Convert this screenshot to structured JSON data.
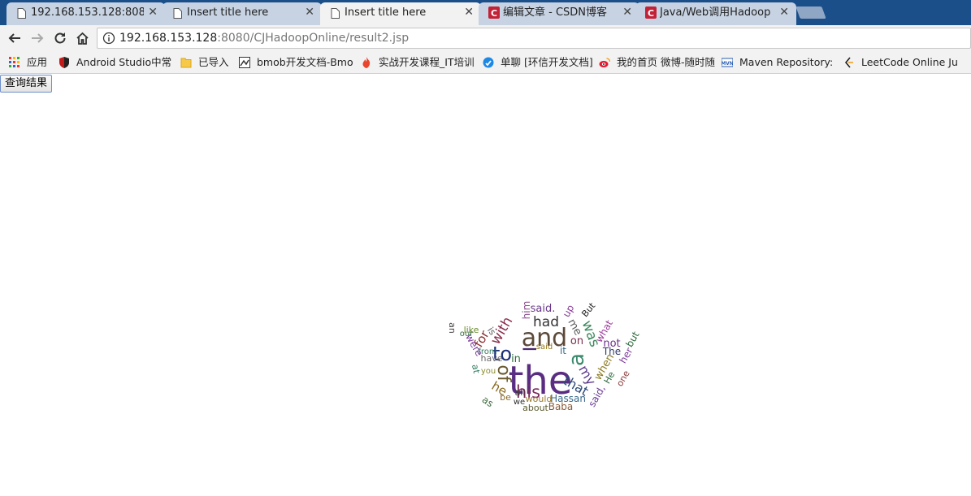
{
  "tabs": [
    {
      "title": "192.168.153.128:8080/",
      "icon": "page-icon"
    },
    {
      "title": "Insert title here",
      "icon": "page-icon"
    },
    {
      "title": "Insert title here",
      "icon": "page-icon",
      "active": true
    },
    {
      "title": "编辑文章 - CSDN博客",
      "icon": "csdn-icon"
    },
    {
      "title": "Java/Web调用Hadoop",
      "icon": "csdn-icon"
    }
  ],
  "address": {
    "host": "192.168.153.128",
    "rest": ":8080/CJHadoopOnline/result2.jsp"
  },
  "bookmarks": [
    {
      "label": "应用",
      "icon": "apps-icon"
    },
    {
      "label": "Android Studio中常",
      "icon": "shield-icon"
    },
    {
      "label": "已导入",
      "icon": "folder-icon"
    },
    {
      "label": "bmob开发文档-Bmo",
      "icon": "bmob-icon"
    },
    {
      "label": "实战开发课程_IT培训",
      "icon": "flame-icon"
    },
    {
      "label": "单聊 [环信开发文档]",
      "icon": "easemob-icon"
    },
    {
      "label": "我的首页 微博-随时随",
      "icon": "weibo-icon"
    },
    {
      "label": "Maven Repository:",
      "icon": "maven-icon"
    },
    {
      "label": "LeetCode Online Ju",
      "icon": "leetcode-icon"
    }
  ],
  "page": {
    "query_button": "查询结果"
  },
  "word_cloud": [
    {
      "text": "the",
      "color": "#5a2d82"
    },
    {
      "text": "and",
      "color": "#5b4a3a"
    },
    {
      "text": "a",
      "color": "#3a8a6e"
    },
    {
      "text": "to",
      "color": "#1c2d7a"
    },
    {
      "text": "of",
      "color": "#6a5a2e"
    },
    {
      "text": "his",
      "color": "#7a2d5a"
    },
    {
      "text": "I",
      "color": "#4b2a6e"
    },
    {
      "text": "had",
      "color": "#333333"
    },
    {
      "text": "was",
      "color": "#3d8a5e"
    },
    {
      "text": "with",
      "color": "#8a2e4e"
    },
    {
      "text": "he",
      "color": "#8a6a1e"
    },
    {
      "text": "my",
      "color": "#5a3a8a"
    },
    {
      "text": "that",
      "color": "#2e4a7a"
    },
    {
      "text": "in",
      "color": "#2e6a3e"
    },
    {
      "text": "for",
      "color": "#8a2e2e"
    },
    {
      "text": "said.",
      "color": "#6a3a8a"
    },
    {
      "text": "him",
      "color": "#8a4a8a"
    },
    {
      "text": "me",
      "color": "#5a5a5a"
    },
    {
      "text": "on",
      "color": "#7a2e4e"
    },
    {
      "text": "it",
      "color": "#3a6a8a"
    },
    {
      "text": "up",
      "color": "#8a3a9a"
    },
    {
      "text": "But",
      "color": "#222222"
    },
    {
      "text": "what",
      "color": "#9a3a9a"
    },
    {
      "text": "but",
      "color": "#2e6a3e"
    },
    {
      "text": "not",
      "color": "#6a2e8a"
    },
    {
      "text": "The",
      "color": "#2e3a6a"
    },
    {
      "text": "her",
      "color": "#7a3a9a"
    },
    {
      "text": "when",
      "color": "#8a7a1e"
    },
    {
      "text": "He",
      "color": "#2e6a3e"
    },
    {
      "text": "one",
      "color": "#8a3a3a"
    },
    {
      "text": "said,",
      "color": "#6a3a9a"
    },
    {
      "text": "Hassan",
      "color": "#3a6a8a"
    },
    {
      "text": "Baba",
      "color": "#8a5a3a"
    },
    {
      "text": "would",
      "color": "#9a7a2e"
    },
    {
      "text": "about",
      "color": "#5a5a2e"
    },
    {
      "text": "we",
      "color": "#2e2e2e"
    },
    {
      "text": "be",
      "color": "#8a6a2e"
    },
    {
      "text": "all",
      "color": "#3a3a3a"
    },
    {
      "text": "as",
      "color": "#3a6a3a"
    },
    {
      "text": "have",
      "color": "#6a6a6a"
    },
    {
      "text": "you",
      "color": "#8a8a2e"
    },
    {
      "text": "at",
      "color": "#2e7a5e"
    },
    {
      "text": "were",
      "color": "#7a3a9a"
    },
    {
      "text": "from",
      "color": "#2e7a5e"
    },
    {
      "text": "is",
      "color": "#5a5a5a"
    },
    {
      "text": "like",
      "color": "#6a8a2e"
    },
    {
      "text": "our",
      "color": "#2e6a3e"
    },
    {
      "text": "an",
      "color": "#444444"
    },
    {
      "text": "said",
      "color": "#9a7a1e"
    }
  ]
}
